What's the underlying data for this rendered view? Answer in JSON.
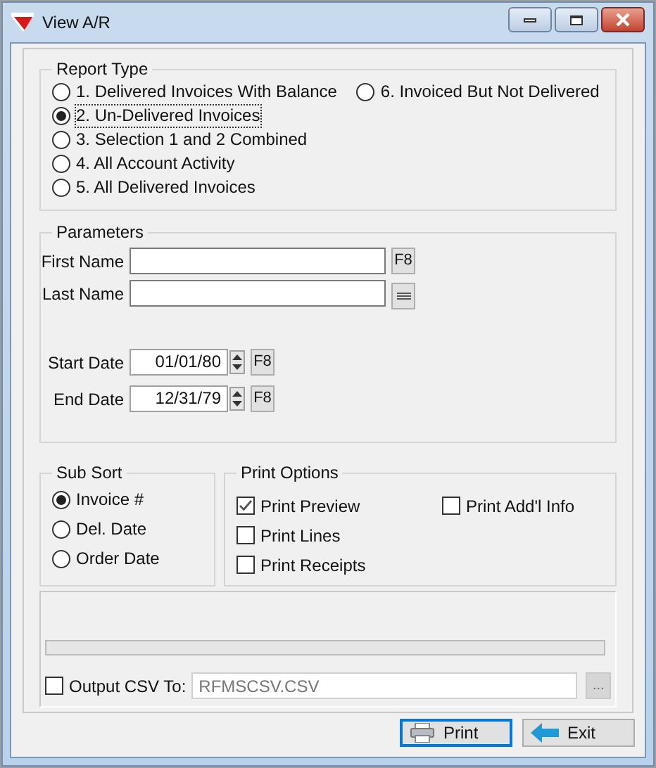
{
  "window": {
    "title": "View A/R"
  },
  "report_type": {
    "title": "Report Type",
    "options": [
      {
        "label": "1. Delivered Invoices With Balance",
        "selected": false
      },
      {
        "label": "2. Un-Delivered Invoices",
        "selected": true
      },
      {
        "label": "3. Selection 1 and 2 Combined",
        "selected": false
      },
      {
        "label": "4. All Account Activity",
        "selected": false
      },
      {
        "label": "5. All Delivered Invoices",
        "selected": false
      },
      {
        "label": "6. Invoiced But Not Delivered",
        "selected": false
      }
    ]
  },
  "parameters": {
    "title": "Parameters",
    "fields": [
      {
        "label": "First Name",
        "kind": "text",
        "button": "F8"
      },
      {
        "label": "Last Name",
        "kind": "text"
      },
      {
        "label": "Start Date",
        "kind": "date",
        "value": "01/01/80",
        "button": "F8"
      },
      {
        "label": "End Date",
        "kind": "date",
        "value": "12/31/79",
        "button": "F8"
      }
    ]
  },
  "sub_sort": {
    "title": "Sub Sort",
    "options": [
      {
        "label": "Invoice #",
        "selected": true
      },
      {
        "label": "Del. Date",
        "selected": false
      },
      {
        "label": "Order Date",
        "selected": false
      }
    ]
  },
  "print_options": {
    "title": "Print Options",
    "options": [
      {
        "label": "Print Preview",
        "checked": true
      },
      {
        "label": "Print Lines",
        "checked": false
      },
      {
        "label": "Print Receipts",
        "checked": false
      },
      {
        "label": "Print Add'l Info",
        "checked": false
      }
    ]
  },
  "output_csv": {
    "label": "Output CSV To:",
    "checked": false,
    "placeholder": "RFMSCSV.CSV",
    "browse": "..."
  },
  "buttons": [
    {
      "label": "Print",
      "kind": "print",
      "default": true
    },
    {
      "label": "Exit",
      "kind": "exit",
      "default": false
    }
  ]
}
